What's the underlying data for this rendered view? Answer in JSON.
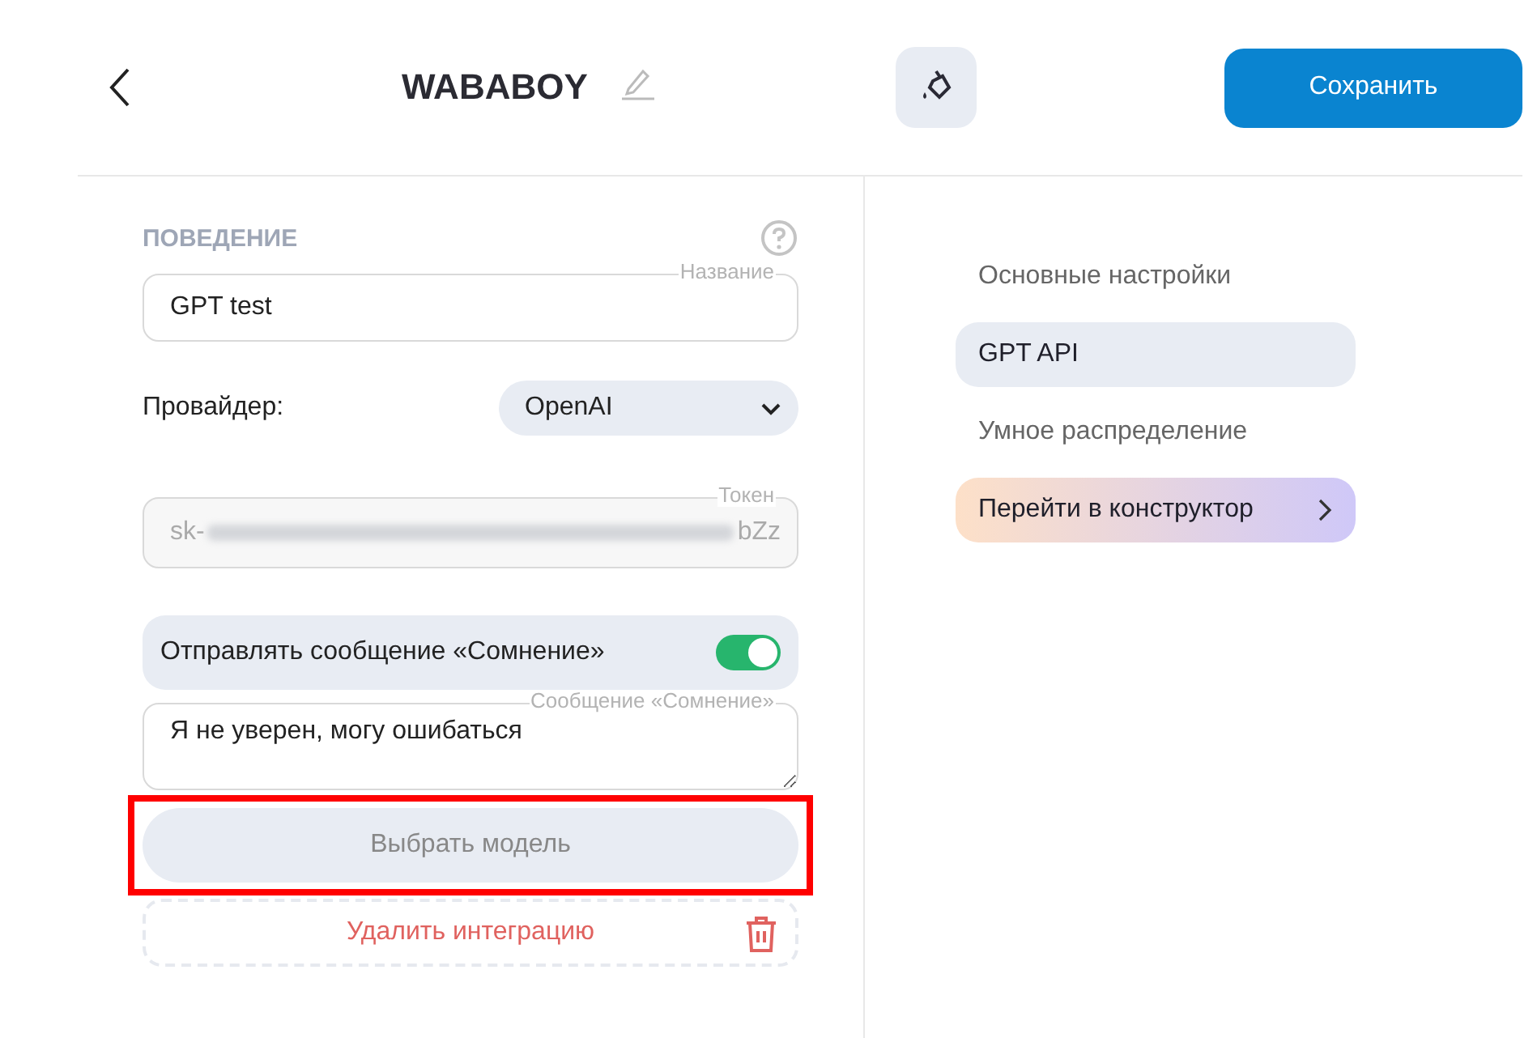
{
  "header": {
    "title": "WABABOY",
    "save_button": "Сохранить"
  },
  "section": {
    "title": "ПОВЕДЕНИЕ"
  },
  "name_field": {
    "label": "Название",
    "value": "GPT test"
  },
  "provider": {
    "label": "Провайдер:",
    "value": "OpenAI"
  },
  "token_field": {
    "label": "Токен",
    "prefix": "sk-",
    "suffix": "bZz"
  },
  "doubt_toggle": {
    "label": "Отправлять сообщение «Сомнение»",
    "on": true
  },
  "doubt_field": {
    "label": "Сообщение «Сомнение»",
    "value": "Я не уверен, могу ошибаться"
  },
  "model_button": {
    "label": "Выбрать модель",
    "highlighted": true
  },
  "delete_button": {
    "label": "Удалить интеграцию"
  },
  "nav": {
    "items": [
      {
        "label": "Основные настройки",
        "kind": "link",
        "selected": false
      },
      {
        "label": "GPT API",
        "kind": "link",
        "selected": true
      },
      {
        "label": "Умное распределение",
        "kind": "link",
        "selected": false
      },
      {
        "label": "Перейти в конструктор",
        "kind": "action",
        "selected": false
      }
    ]
  }
}
